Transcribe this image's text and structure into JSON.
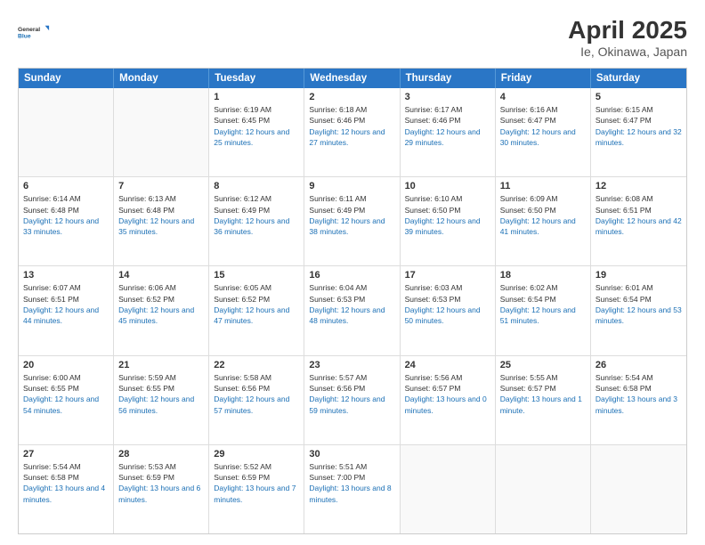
{
  "header": {
    "logo_general": "General",
    "logo_blue": "Blue",
    "title": "April 2025",
    "subtitle": "Ie, Okinawa, Japan"
  },
  "weekdays": [
    "Sunday",
    "Monday",
    "Tuesday",
    "Wednesday",
    "Thursday",
    "Friday",
    "Saturday"
  ],
  "weeks": [
    [
      {
        "day": "",
        "sunrise": "",
        "sunset": "",
        "daylight": ""
      },
      {
        "day": "",
        "sunrise": "",
        "sunset": "",
        "daylight": ""
      },
      {
        "day": "1",
        "sunrise": "Sunrise: 6:19 AM",
        "sunset": "Sunset: 6:45 PM",
        "daylight": "Daylight: 12 hours and 25 minutes."
      },
      {
        "day": "2",
        "sunrise": "Sunrise: 6:18 AM",
        "sunset": "Sunset: 6:46 PM",
        "daylight": "Daylight: 12 hours and 27 minutes."
      },
      {
        "day": "3",
        "sunrise": "Sunrise: 6:17 AM",
        "sunset": "Sunset: 6:46 PM",
        "daylight": "Daylight: 12 hours and 29 minutes."
      },
      {
        "day": "4",
        "sunrise": "Sunrise: 6:16 AM",
        "sunset": "Sunset: 6:47 PM",
        "daylight": "Daylight: 12 hours and 30 minutes."
      },
      {
        "day": "5",
        "sunrise": "Sunrise: 6:15 AM",
        "sunset": "Sunset: 6:47 PM",
        "daylight": "Daylight: 12 hours and 32 minutes."
      }
    ],
    [
      {
        "day": "6",
        "sunrise": "Sunrise: 6:14 AM",
        "sunset": "Sunset: 6:48 PM",
        "daylight": "Daylight: 12 hours and 33 minutes."
      },
      {
        "day": "7",
        "sunrise": "Sunrise: 6:13 AM",
        "sunset": "Sunset: 6:48 PM",
        "daylight": "Daylight: 12 hours and 35 minutes."
      },
      {
        "day": "8",
        "sunrise": "Sunrise: 6:12 AM",
        "sunset": "Sunset: 6:49 PM",
        "daylight": "Daylight: 12 hours and 36 minutes."
      },
      {
        "day": "9",
        "sunrise": "Sunrise: 6:11 AM",
        "sunset": "Sunset: 6:49 PM",
        "daylight": "Daylight: 12 hours and 38 minutes."
      },
      {
        "day": "10",
        "sunrise": "Sunrise: 6:10 AM",
        "sunset": "Sunset: 6:50 PM",
        "daylight": "Daylight: 12 hours and 39 minutes."
      },
      {
        "day": "11",
        "sunrise": "Sunrise: 6:09 AM",
        "sunset": "Sunset: 6:50 PM",
        "daylight": "Daylight: 12 hours and 41 minutes."
      },
      {
        "day": "12",
        "sunrise": "Sunrise: 6:08 AM",
        "sunset": "Sunset: 6:51 PM",
        "daylight": "Daylight: 12 hours and 42 minutes."
      }
    ],
    [
      {
        "day": "13",
        "sunrise": "Sunrise: 6:07 AM",
        "sunset": "Sunset: 6:51 PM",
        "daylight": "Daylight: 12 hours and 44 minutes."
      },
      {
        "day": "14",
        "sunrise": "Sunrise: 6:06 AM",
        "sunset": "Sunset: 6:52 PM",
        "daylight": "Daylight: 12 hours and 45 minutes."
      },
      {
        "day": "15",
        "sunrise": "Sunrise: 6:05 AM",
        "sunset": "Sunset: 6:52 PM",
        "daylight": "Daylight: 12 hours and 47 minutes."
      },
      {
        "day": "16",
        "sunrise": "Sunrise: 6:04 AM",
        "sunset": "Sunset: 6:53 PM",
        "daylight": "Daylight: 12 hours and 48 minutes."
      },
      {
        "day": "17",
        "sunrise": "Sunrise: 6:03 AM",
        "sunset": "Sunset: 6:53 PM",
        "daylight": "Daylight: 12 hours and 50 minutes."
      },
      {
        "day": "18",
        "sunrise": "Sunrise: 6:02 AM",
        "sunset": "Sunset: 6:54 PM",
        "daylight": "Daylight: 12 hours and 51 minutes."
      },
      {
        "day": "19",
        "sunrise": "Sunrise: 6:01 AM",
        "sunset": "Sunset: 6:54 PM",
        "daylight": "Daylight: 12 hours and 53 minutes."
      }
    ],
    [
      {
        "day": "20",
        "sunrise": "Sunrise: 6:00 AM",
        "sunset": "Sunset: 6:55 PM",
        "daylight": "Daylight: 12 hours and 54 minutes."
      },
      {
        "day": "21",
        "sunrise": "Sunrise: 5:59 AM",
        "sunset": "Sunset: 6:55 PM",
        "daylight": "Daylight: 12 hours and 56 minutes."
      },
      {
        "day": "22",
        "sunrise": "Sunrise: 5:58 AM",
        "sunset": "Sunset: 6:56 PM",
        "daylight": "Daylight: 12 hours and 57 minutes."
      },
      {
        "day": "23",
        "sunrise": "Sunrise: 5:57 AM",
        "sunset": "Sunset: 6:56 PM",
        "daylight": "Daylight: 12 hours and 59 minutes."
      },
      {
        "day": "24",
        "sunrise": "Sunrise: 5:56 AM",
        "sunset": "Sunset: 6:57 PM",
        "daylight": "Daylight: 13 hours and 0 minutes."
      },
      {
        "day": "25",
        "sunrise": "Sunrise: 5:55 AM",
        "sunset": "Sunset: 6:57 PM",
        "daylight": "Daylight: 13 hours and 1 minute."
      },
      {
        "day": "26",
        "sunrise": "Sunrise: 5:54 AM",
        "sunset": "Sunset: 6:58 PM",
        "daylight": "Daylight: 13 hours and 3 minutes."
      }
    ],
    [
      {
        "day": "27",
        "sunrise": "Sunrise: 5:54 AM",
        "sunset": "Sunset: 6:58 PM",
        "daylight": "Daylight: 13 hours and 4 minutes."
      },
      {
        "day": "28",
        "sunrise": "Sunrise: 5:53 AM",
        "sunset": "Sunset: 6:59 PM",
        "daylight": "Daylight: 13 hours and 6 minutes."
      },
      {
        "day": "29",
        "sunrise": "Sunrise: 5:52 AM",
        "sunset": "Sunset: 6:59 PM",
        "daylight": "Daylight: 13 hours and 7 minutes."
      },
      {
        "day": "30",
        "sunrise": "Sunrise: 5:51 AM",
        "sunset": "Sunset: 7:00 PM",
        "daylight": "Daylight: 13 hours and 8 minutes."
      },
      {
        "day": "",
        "sunrise": "",
        "sunset": "",
        "daylight": ""
      },
      {
        "day": "",
        "sunrise": "",
        "sunset": "",
        "daylight": ""
      },
      {
        "day": "",
        "sunrise": "",
        "sunset": "",
        "daylight": ""
      }
    ]
  ]
}
